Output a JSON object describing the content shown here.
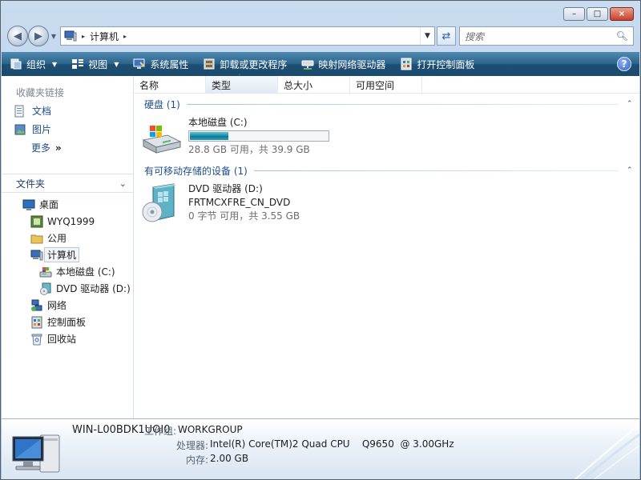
{
  "window": {
    "caption_buttons": {
      "minimize": "–",
      "maximize": "□",
      "close": "×"
    }
  },
  "nav": {
    "back_icon": "arrow-left-icon",
    "forward_icon": "arrow-right-icon",
    "address": {
      "path": [
        "计算机"
      ],
      "sep": "▸"
    },
    "search_placeholder": "搜索"
  },
  "toolbar": {
    "items": [
      {
        "label": "组织",
        "icon": "organize-icon",
        "dropdown": true
      },
      {
        "label": "视图",
        "icon": "views-icon",
        "dropdown": true
      },
      {
        "label": "系统属性",
        "icon": "system-properties-icon"
      },
      {
        "label": "卸载或更改程序",
        "icon": "uninstall-icon"
      },
      {
        "label": "映射网络驱动器",
        "icon": "map-drive-icon"
      },
      {
        "label": "打开控制面板",
        "icon": "control-panel-icon"
      }
    ],
    "help": "?"
  },
  "sidebar": {
    "favorites_header": "收藏夹链接",
    "favorites": [
      {
        "label": "文档",
        "icon": "documents-icon"
      },
      {
        "label": "图片",
        "icon": "pictures-icon"
      },
      {
        "label": "更多",
        "icon": "more-chevron-icon"
      }
    ],
    "more_chevron": "»",
    "folders_label": "文件夹",
    "folders_chevron": "⌄",
    "tree": [
      {
        "label": "桌面",
        "level": 0,
        "icon": "desktop-icon"
      },
      {
        "label": "WYQ1999",
        "level": 1,
        "icon": "user-folder-icon"
      },
      {
        "label": "公用",
        "level": 1,
        "icon": "folder-icon"
      },
      {
        "label": "计算机",
        "level": 1,
        "icon": "computer-icon",
        "selected": true
      },
      {
        "label": "本地磁盘 (C:)",
        "level": 2,
        "icon": "hard-drive-icon"
      },
      {
        "label": "DVD 驱动器 (D:)",
        "level": 2,
        "icon": "dvd-drive-icon"
      },
      {
        "label": "网络",
        "level": 1,
        "icon": "network-icon"
      },
      {
        "label": "控制面板",
        "level": 1,
        "icon": "control-panel-icon"
      },
      {
        "label": "回收站",
        "level": 1,
        "icon": "recycle-bin-icon"
      }
    ]
  },
  "main": {
    "columns": [
      "名称",
      "类型",
      "总大小",
      "可用空间"
    ],
    "sort_indicator": "ˆ",
    "groups": [
      {
        "title": "硬盘 (1)",
        "collapse": "⌃",
        "items": [
          {
            "name": "本地磁盘 (C:)",
            "sub": "28.8 GB 可用，共 39.9 GB",
            "used_fraction": 0.28,
            "icon": "hard-drive-icon"
          }
        ]
      },
      {
        "title": "有可移动存储的设备 (1)",
        "collapse": "⌃",
        "items": [
          {
            "name": "DVD 驱动器 (D:)",
            "label": "FRTMCXFRE_CN_DVD",
            "sub": "0 字节 可用，共 3.55 GB",
            "icon": "dvd-drive-icon"
          }
        ]
      }
    ]
  },
  "details": {
    "computer_name": "WIN-L00BDK1UOI0",
    "workgroup_label": "工作组:",
    "workgroup": "WORKGROUP",
    "processor_label": "处理器:",
    "processor": "Intel(R) Core(TM)2 Quad CPU    Q9650  @ 3.00GHz",
    "memory_label": "内存:",
    "memory": "2.00 GB"
  }
}
